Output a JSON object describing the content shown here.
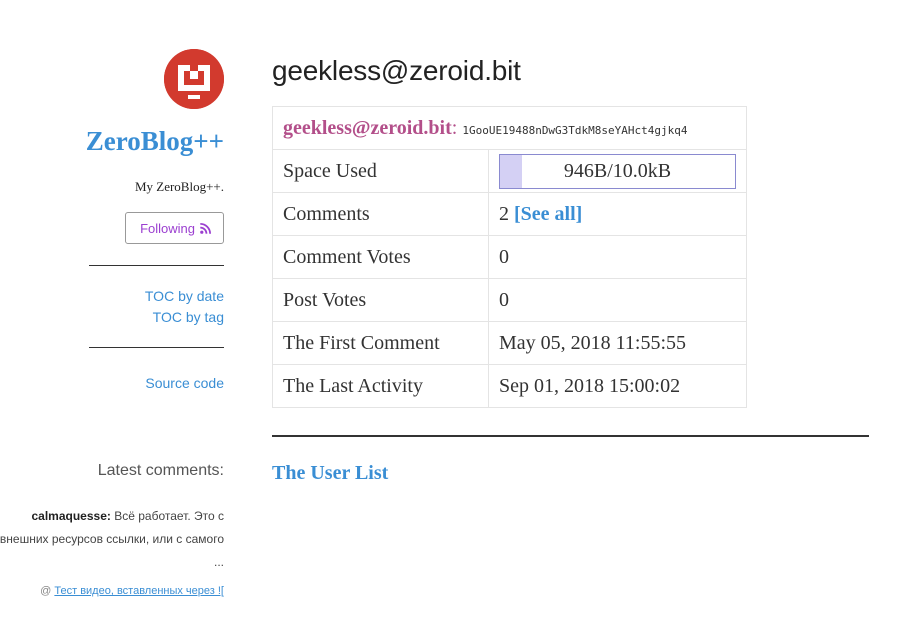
{
  "sidebar": {
    "blog_title": "ZeroBlog++",
    "blog_description": "My ZeroBlog++.",
    "follow_label": "Following",
    "toc_by_date": "TOC by date",
    "toc_by_tag": "TOC by tag",
    "source_code": "Source code",
    "latest_comments_heading": "Latest comments:",
    "latest_comment": {
      "author": "calmaquesse:",
      "text": "Всё работает. Это с внешних ресурсов ссылки, или с самого ...",
      "at_symbol": "@",
      "post_link": "Тест видео, вставленных через !["
    }
  },
  "main": {
    "page_title": "geekless@zeroid.bit",
    "table": {
      "header_name": "geekless@zeroid.bit",
      "header_colon": ":",
      "header_address": "1GooUE19488nDwG3TdkM8seYAHct4gjkq4",
      "rows": {
        "space_used": {
          "label": "Space Used",
          "value": "946B/10.0kB",
          "fill_fraction": 0.0946
        },
        "comments": {
          "label": "Comments",
          "value": "2",
          "link": "[See all]"
        },
        "comment_votes": {
          "label": "Comment Votes",
          "value": "0"
        },
        "post_votes": {
          "label": "Post Votes",
          "value": "0"
        },
        "first_comment": {
          "label": "The First Comment",
          "value": "May 05, 2018 11:55:55"
        },
        "last_activity": {
          "label": "The Last Activity",
          "value": "Sep 01, 2018 15:00:02"
        }
      }
    },
    "user_list_link": "The User List"
  },
  "colors": {
    "accent_blue": "#3a8ed4",
    "follow_purple": "#9b3fd0",
    "name_pink": "#b34f8a",
    "avatar_red": "#d23a2e",
    "space_fill": "#d4d0f4"
  }
}
